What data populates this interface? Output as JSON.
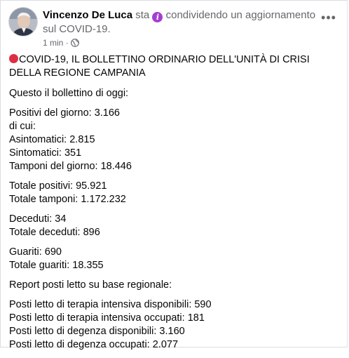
{
  "post": {
    "author": "Vincenzo De Luca",
    "action_prefix": "sta",
    "action_suffix": "condividendo un aggiornamento sul COVID-19.",
    "time": "1 min",
    "separator": "·",
    "icons": {
      "info": "info-icon",
      "audience": "globe-icon",
      "more": "more-options-icon"
    },
    "colors": {
      "info_badge": "#a43ed1",
      "red_circle": "#dd2e44",
      "secondary_text": "#65676b"
    }
  },
  "content": {
    "title": "COVID-19, IL BOLLETTINO ORDINARIO DELL'UNITÀ DI CRISI DELLA REGIONE CAMPANIA",
    "paragraphs": [
      [
        "Questo il bollettino di oggi:"
      ],
      [
        "Positivi del giorno: 3.166",
        "di cui:",
        "Asintomatici: 2.815",
        "Sintomatici: 351",
        "Tamponi del giorno: 18.446"
      ],
      [
        "Totale positivi: 95.921",
        "Totale tamponi: 1.172.232"
      ],
      [
        "Deceduti: 34",
        "Totale deceduti: 896"
      ],
      [
        "Guariti: 690",
        "Totale guariti: 18.355"
      ],
      [
        "Report posti letto su base regionale:"
      ],
      [
        "Posti letto di terapia intensiva disponibili: 590",
        "Posti letto di terapia intensiva occupati: 181",
        "Posti letto di degenza disponibili: 3.160",
        "Posti letto di degenza occupati: 2.077"
      ]
    ]
  }
}
